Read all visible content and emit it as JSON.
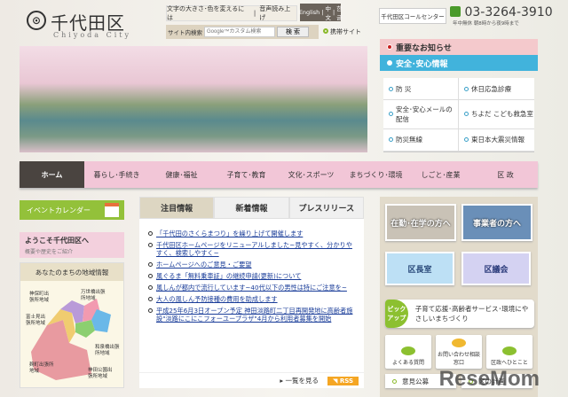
{
  "header": {
    "logo_jp": "千代田区",
    "logo_en": "Chiyoda City",
    "text_size": "文字の大きさ･色を変えるには",
    "voice": "音声読み上げ",
    "lang": [
      "English",
      "中文",
      "한글"
    ],
    "search_label": "サイト内検索",
    "search_placeholder": "Google™カスタム検索",
    "search_button": "検 索",
    "mobile": "携帯サイト",
    "call_center": "千代田区コールセンター",
    "phone": "03-3264-3910",
    "phone_hours": "年中無休 朝8時から夜9時まで"
  },
  "notices": {
    "important": "重要なお知らせ",
    "safety": "安全･安心情報",
    "items": [
      "防 災",
      "休日応急診療",
      "安全･安心メールの配信",
      "ちよだ こども救急室",
      "防災無線",
      "東日本大震災情報"
    ]
  },
  "nav": [
    "ホーム",
    "暮らし･手続き",
    "健康･福祉",
    "子育て･教育",
    "文化･スポーツ",
    "まちづくり･環境",
    "しごと･産業",
    "区 政"
  ],
  "left": {
    "event": "イベントカレンダー",
    "welcome": "ようこそ千代田区へ",
    "welcome_sub": "概要や歴史をご紹介",
    "area_title": "あなたのまちの地域情報",
    "areas": [
      "神保町出張所地域",
      "万世橋出張所地域",
      "富士見出張所地域",
      "和泉橋出張所地域",
      "麹町出張所地域",
      "神田公園出張所地域"
    ]
  },
  "center": {
    "tabs": [
      "注目情報",
      "新着情報",
      "プレスリリース"
    ],
    "news": [
      "「千代田のさくらまつり」を繰り上げて開催します",
      "千代田区ホームページをリニューアルしました~見やすく、分かりやすく、検索しやすく~",
      "ホームページへのご意見・ご要望",
      "風ぐるま「無料乗車証」の継続申請(更新)について",
      "風しんが都内で流行しています~40代以下の男性は特にご注意を~",
      "大人の風しん予防接種の費用を助成します",
      "平成25年6月3日オープン予定 神田淡路町二丁目再開発地に高齢者施設\"淡路にこにこフォーユープラザ\"4月から利用者募集を開始"
    ],
    "more": "一覧を見る",
    "rss": "RSS"
  },
  "right": {
    "commuters": "在勤･在学の方へ",
    "business": "事業者の方へ",
    "mayor": "区長室",
    "assembly": "区議会",
    "pickup_badge": "ピックアップ",
    "pickup": "子育て応援･高齢者サービス･環境にやさしいまちづくり",
    "faq": "よくある質問",
    "contact": "お問い合わせ相談窓口",
    "opinion": "区政へひとこと",
    "public_comment": "意見公募",
    "other": "区の計画"
  },
  "watermark": "ReseMom"
}
